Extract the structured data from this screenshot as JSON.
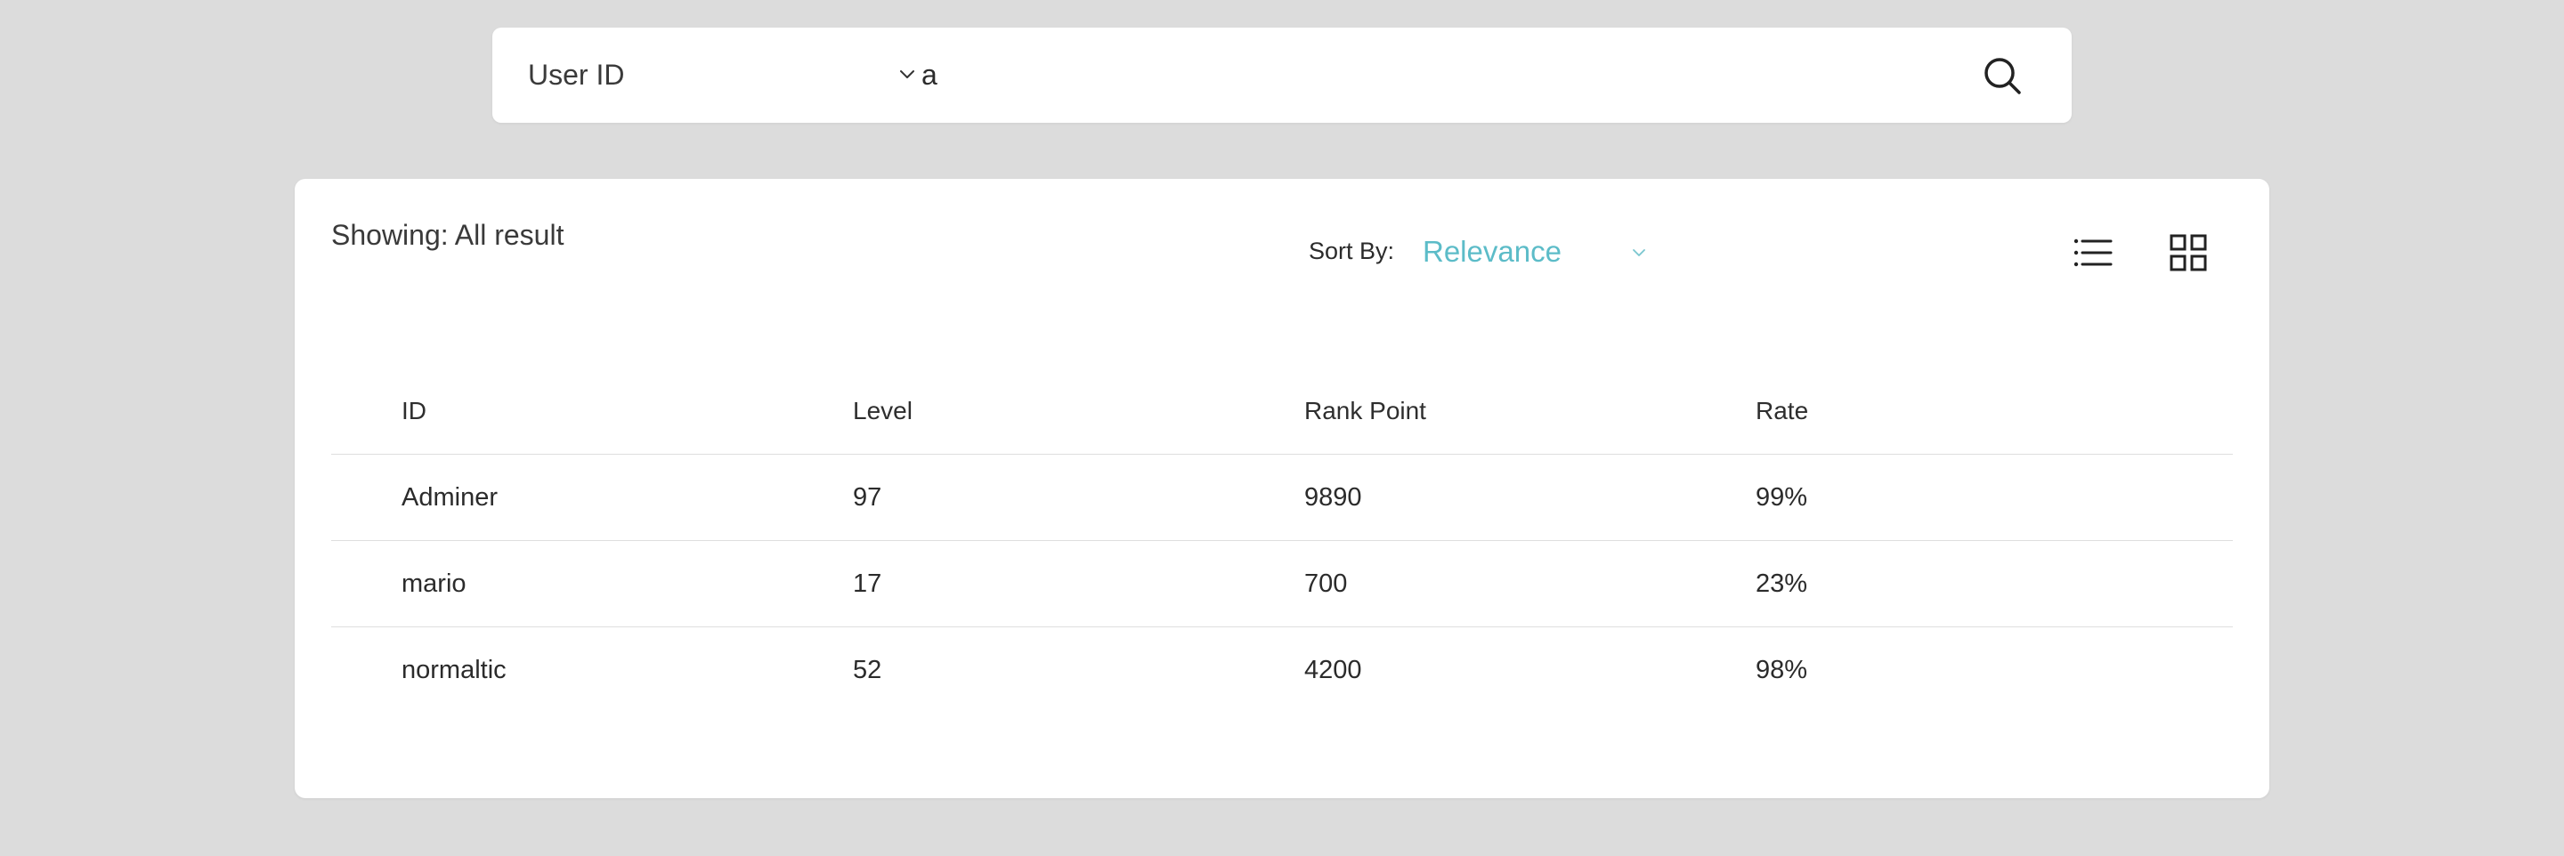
{
  "search": {
    "type_label": "User ID",
    "query_value": "a",
    "placeholder": ""
  },
  "results": {
    "showing_label": "Showing: All result",
    "sort_by_label": "Sort By:",
    "sort_value": "Relevance",
    "accent_color": "#5cbcc8"
  },
  "table": {
    "columns": [
      "ID",
      "Level",
      "Rank Point",
      "Rate"
    ],
    "rows": [
      [
        "Adminer",
        "97",
        "9890",
        "99%"
      ],
      [
        "mario",
        "17",
        "700",
        "23%"
      ],
      [
        "normaltic",
        "52",
        "4200",
        "98%"
      ]
    ]
  },
  "icons": {
    "search_button": "search-icon",
    "type_dropdown": "chevron-down-icon",
    "sort_dropdown": "chevron-down-icon",
    "list_view": "list-view-icon",
    "grid_view": "grid-view-icon"
  }
}
